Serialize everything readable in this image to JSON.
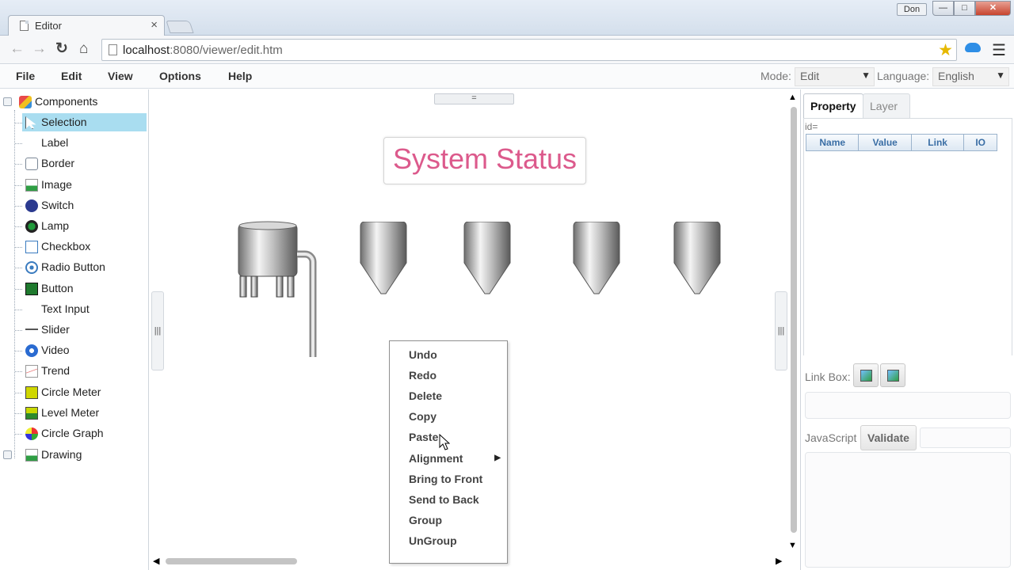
{
  "browser": {
    "tab_title": "Editor",
    "tab_close": "×",
    "user": "Don",
    "url_host": "localhost",
    "url_rest": ":8080/viewer/edit.htm",
    "win_min": "—",
    "win_max": "□",
    "win_close": "✕"
  },
  "menubar": {
    "items": [
      "File",
      "Edit",
      "View",
      "Options",
      "Help"
    ],
    "mode_label": "Mode:",
    "mode_value": "Edit",
    "language_label": "Language:",
    "language_value": "English"
  },
  "tree": {
    "root": "Components",
    "items": [
      {
        "label": "Selection",
        "icon": "selection-icon",
        "selected": true
      },
      {
        "label": "Label",
        "icon": "label-icon"
      },
      {
        "label": "Border",
        "icon": "border-icon"
      },
      {
        "label": "Image",
        "icon": "image-icon"
      },
      {
        "label": "Switch",
        "icon": "switch-icon"
      },
      {
        "label": "Lamp",
        "icon": "lamp-icon"
      },
      {
        "label": "Checkbox",
        "icon": "checkbox-icon"
      },
      {
        "label": "Radio Button",
        "icon": "radio-icon"
      },
      {
        "label": "Button",
        "icon": "button-icon"
      },
      {
        "label": "Text Input",
        "icon": "text-input-icon"
      },
      {
        "label": "Slider",
        "icon": "slider-icon"
      },
      {
        "label": "Video",
        "icon": "video-icon"
      },
      {
        "label": "Trend",
        "icon": "trend-icon"
      },
      {
        "label": "Circle Meter",
        "icon": "circle-meter-icon"
      },
      {
        "label": "Level Meter",
        "icon": "level-meter-icon"
      },
      {
        "label": "Circle Graph",
        "icon": "circle-graph-icon"
      }
    ],
    "second_root": "Drawing"
  },
  "canvas": {
    "title": "System Status",
    "top_handle": "=",
    "side_handle": "|||"
  },
  "context_menu": {
    "items": [
      "Undo",
      "Redo",
      "Delete",
      "Copy",
      "Paste",
      "Alignment",
      "Bring to Front",
      "Send to Back",
      "Group",
      "UnGroup"
    ],
    "submenu_arrow": "▶"
  },
  "right_panel": {
    "tab_property": "Property",
    "tab_layer": "Layer",
    "id_label": "id=",
    "columns": [
      "Name",
      "Value",
      "Link",
      "IO"
    ],
    "link_box_label": "Link Box:",
    "javascript_label": "JavaScript",
    "validate_button": "Validate"
  }
}
